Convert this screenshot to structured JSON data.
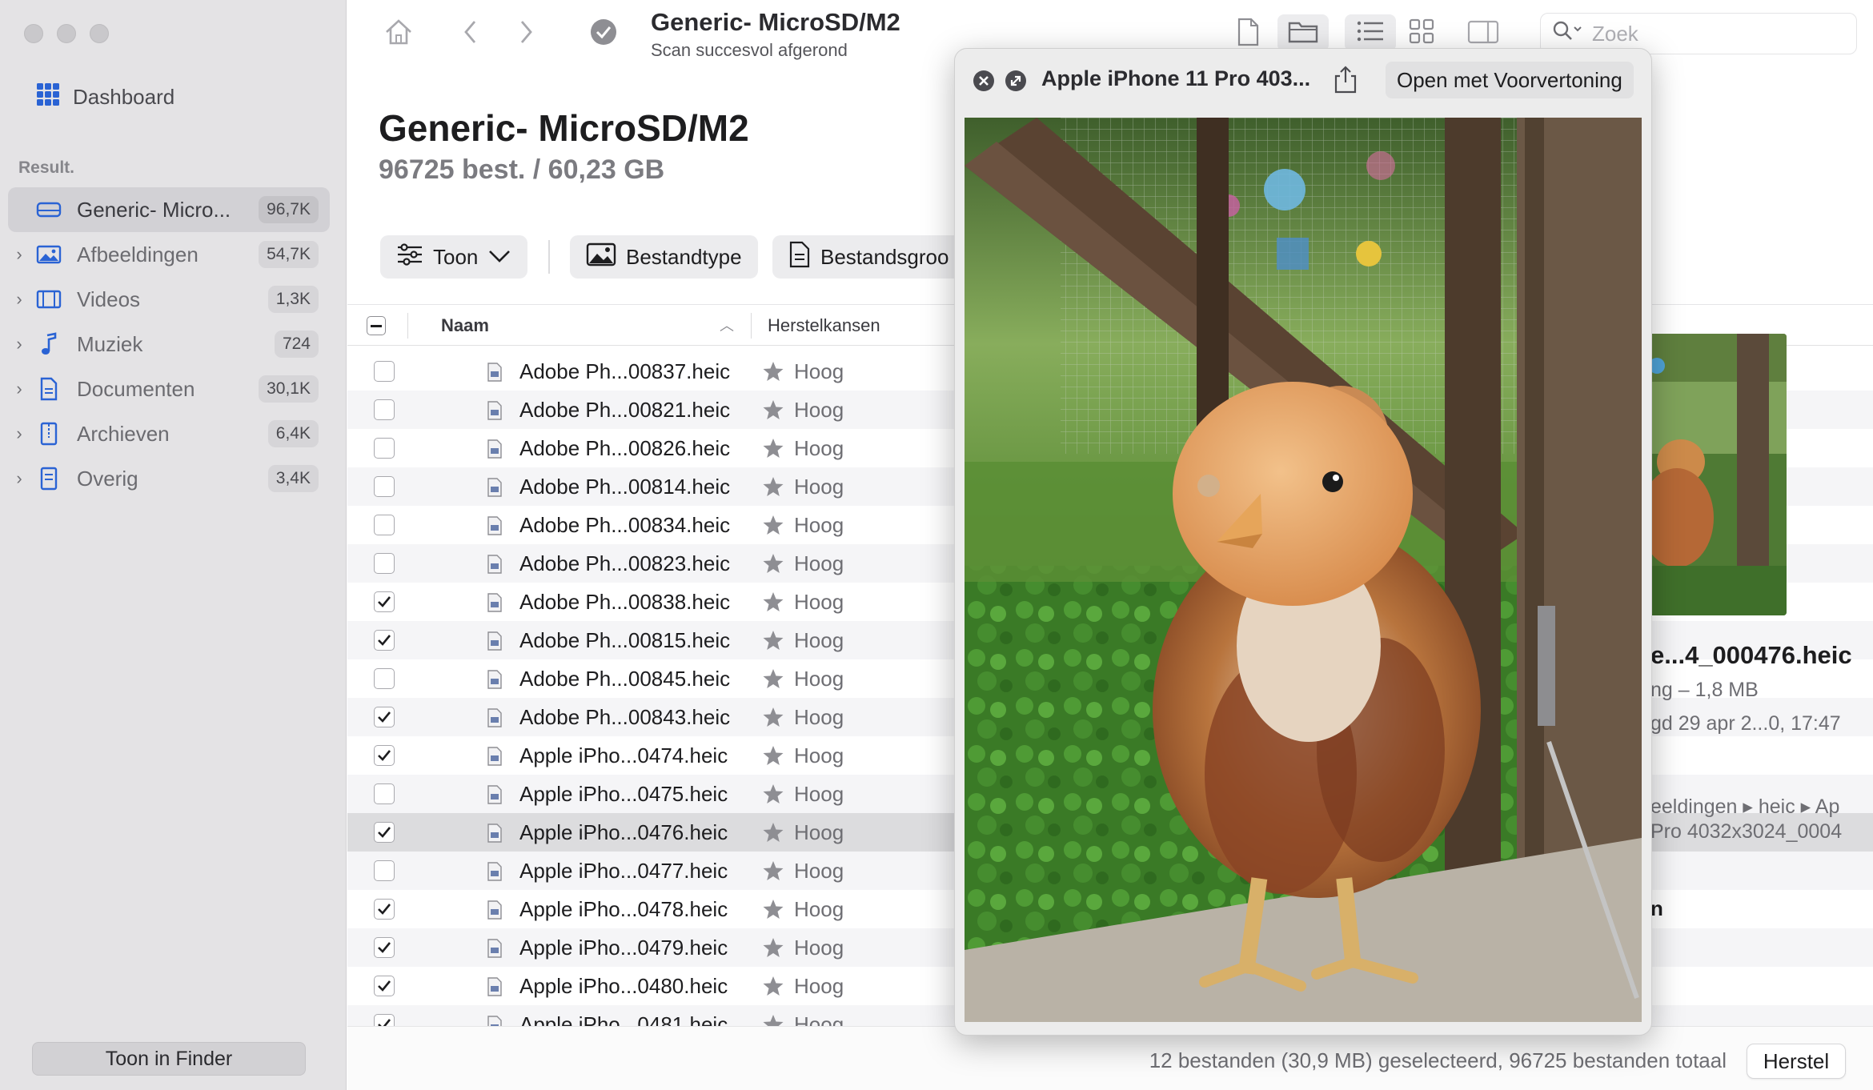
{
  "sidebar": {
    "dashboard": "Dashboard",
    "section": "Result.",
    "items": [
      {
        "label": "Generic- Micro...",
        "count": "96,7K",
        "icon": "drive-icon"
      },
      {
        "label": "Afbeeldingen",
        "count": "54,7K",
        "icon": "photo-icon"
      },
      {
        "label": "Videos",
        "count": "1,3K",
        "icon": "film-icon"
      },
      {
        "label": "Muziek",
        "count": "724",
        "icon": "music-note-icon"
      },
      {
        "label": "Documenten",
        "count": "30,1K",
        "icon": "document-icon"
      },
      {
        "label": "Archieven",
        "count": "6,4K",
        "icon": "archive-icon"
      },
      {
        "label": "Overig",
        "count": "3,4K",
        "icon": "other-icon"
      }
    ],
    "finder_button": "Toon in Finder"
  },
  "toolbar": {
    "title": "Generic- MicroSD/M2",
    "subtitle": "Scan succesvol afgerond",
    "search_placeholder": "Zoek"
  },
  "header": {
    "title": "Generic- MicroSD/M2",
    "summary": "96725 best. / 60,23 GB"
  },
  "filters": {
    "show": "Toon",
    "filetype": "Bestandtype",
    "filesize": "Bestandsgroo"
  },
  "table": {
    "col_name": "Naam",
    "col_recovery": "Herstelkansen",
    "rows": [
      {
        "name": "Adobe Ph...00837.heic",
        "chance": "Hoog",
        "checked": false
      },
      {
        "name": "Adobe Ph...00821.heic",
        "chance": "Hoog",
        "checked": false
      },
      {
        "name": "Adobe Ph...00826.heic",
        "chance": "Hoog",
        "checked": false
      },
      {
        "name": "Adobe Ph...00814.heic",
        "chance": "Hoog",
        "checked": false
      },
      {
        "name": "Adobe Ph...00834.heic",
        "chance": "Hoog",
        "checked": false
      },
      {
        "name": "Adobe Ph...00823.heic",
        "chance": "Hoog",
        "checked": false
      },
      {
        "name": "Adobe Ph...00838.heic",
        "chance": "Hoog",
        "checked": true
      },
      {
        "name": "Adobe Ph...00815.heic",
        "chance": "Hoog",
        "checked": true
      },
      {
        "name": "Adobe Ph...00845.heic",
        "chance": "Hoog",
        "checked": false
      },
      {
        "name": "Adobe Ph...00843.heic",
        "chance": "Hoog",
        "checked": true
      },
      {
        "name": "Apple iPho...0474.heic",
        "chance": "Hoog",
        "checked": true
      },
      {
        "name": "Apple iPho...0475.heic",
        "chance": "Hoog",
        "checked": false
      },
      {
        "name": "Apple iPho...0476.heic",
        "chance": "Hoog",
        "checked": true,
        "selected": true
      },
      {
        "name": "Apple iPho...0477.heic",
        "chance": "Hoog",
        "checked": false
      },
      {
        "name": "Apple iPho...0478.heic",
        "chance": "Hoog",
        "checked": true
      },
      {
        "name": "Apple iPho...0479.heic",
        "chance": "Hoog",
        "checked": true
      },
      {
        "name": "Apple iPho...0480.heic",
        "chance": "Hoog",
        "checked": true
      },
      {
        "name": "Apple iPho...0481.heic",
        "chance": "Hoog",
        "checked": true
      }
    ]
  },
  "info": {
    "name": "e...4_000476.heic",
    "size": "ng – 1,8 MB",
    "date": "gd  29 apr 2...0, 17:47",
    "path1": "eeldingen ▸ heic ▸ Ap",
    "path2": "Pro 4032x3024_0004",
    "label_n": "n"
  },
  "status": {
    "text": "12 bestanden (30,9 MB) geselecteerd, 96725 bestanden totaal",
    "recover_button": "Herstel"
  },
  "quicklook": {
    "title": "Apple iPhone 11 Pro 403...",
    "open_button": "Open met Voorvertoning"
  },
  "colors": {
    "accent": "#2a63d4",
    "sidebar_bg": "#e4e3e5",
    "selected_row": "#dcdcde"
  }
}
